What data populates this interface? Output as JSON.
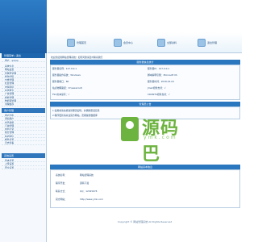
{
  "sidebar": {
    "header_main": "管理菜单 | 退出",
    "user_line": "用户：admin",
    "header_group2": "用户管理",
    "header_group3": "系统设置",
    "items_a": [
      "系统信息",
      "网站设置",
      "管理员管理",
      "修改密码",
      "文章管理",
      "栏目管理",
      "友情链接",
      "在线留言",
      "广告管理",
      "模板管理",
      "数据库管理",
      "清理缓存"
    ],
    "items_b": [
      "用户列表",
      "添加用户",
      "会员等级",
      "订单管理",
      "充值记录",
      "积分管理",
      "站内短信",
      "邮件设置",
      "日志查看"
    ],
    "items_c": [
      "基本设置",
      "上传设置",
      "安全设置"
    ]
  },
  "topbar": {
    "nav": [
      "管理首页",
      "会员中心",
      "全部资料",
      "退出管理"
    ]
  },
  "main": {
    "welcome_line": "欢迎您使用网站管理系统！如有问题请及时联系我们",
    "section_system": "服务器信息统计",
    "system_rows": [
      {
        "left": "服务器名称：127.0.0.1",
        "right": "服务器IP：127.0.0.1"
      },
      {
        "left": "服务器操作系统：Windows",
        "right": "脚本解释引擎：Microsoft IIS"
      },
      {
        "left": "服务器端口：80",
        "right": "服务器时间：2016-01-01"
      },
      {
        "left": "站点物理路径：D:\\wwwroot\\",
        "right": "Jmail组件支持：√"
      },
      {
        "left": "FSO文本读写：√",
        "right": "CDONTS组件支持：√"
      }
    ],
    "section_notice": "管理员公告",
    "notice_lines": [
      "1.使用前请先修改管理员密码，并删除安装目录",
      "2.程序更新请关注官方网站，定期备份数据库"
    ],
    "section_info": "网站基本信息",
    "info_rows": [
      {
        "label": "系统名称：",
        "value": "网站管理系统"
      },
      {
        "label": "程序开发：",
        "value": "源码下载"
      },
      {
        "label": "联系方式：",
        "value": "QQ：12345678"
      },
      {
        "label": "官方网站：",
        "value": "http://www.ymk.com"
      }
    ]
  },
  "watermark": {
    "title": "源码巴",
    "subtitle": "ymk.com"
  },
  "footer": {
    "text": "Copyright © 网站管理系统 All Rights Reserved"
  },
  "colors": {
    "accent": "#2a77c0",
    "sidebar_bg": "#f5f9fd",
    "watermark": "#6db33f"
  }
}
